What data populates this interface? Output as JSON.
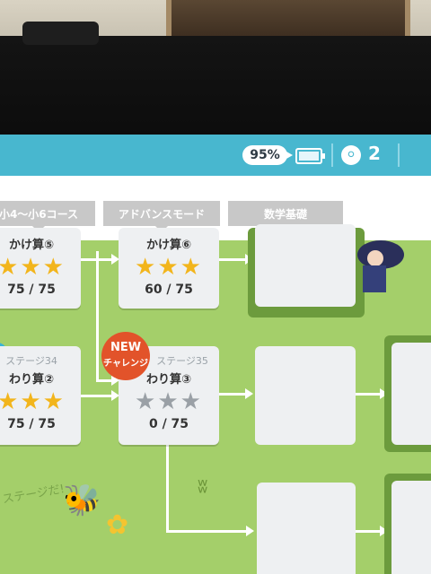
{
  "status": {
    "battery_percent": "95%",
    "key_count": "2"
  },
  "tabs": [
    {
      "label": "小4〜小6コース"
    },
    {
      "label": "アドバンスモード"
    },
    {
      "label": "数学基礎"
    }
  ],
  "cards": {
    "top_left": {
      "title": "かけ算⑤",
      "stars_on": 3,
      "stars_off": 0,
      "score": "75 / 75"
    },
    "top_mid": {
      "title": "かけ算⑥",
      "stars_on": 3,
      "stars_off": 0,
      "score": "60 / 75"
    },
    "mid_left": {
      "stage": "ステージ34",
      "title": "わり算②",
      "stars_on": 3,
      "stars_off": 0,
      "score": "75 / 75"
    },
    "mid_mid": {
      "stage": "ステージ35",
      "title": "わり算③",
      "stars_on": 0,
      "stars_off": 3,
      "score": "0 / 75"
    }
  },
  "badge": {
    "line1": "NEW",
    "line2": "チャレンジ"
  },
  "doodle": "ステージだ!",
  "icons": {
    "battery": "battery-icon",
    "key": "key-icon",
    "bee": "bee-icon",
    "flower": "flower-icon"
  }
}
